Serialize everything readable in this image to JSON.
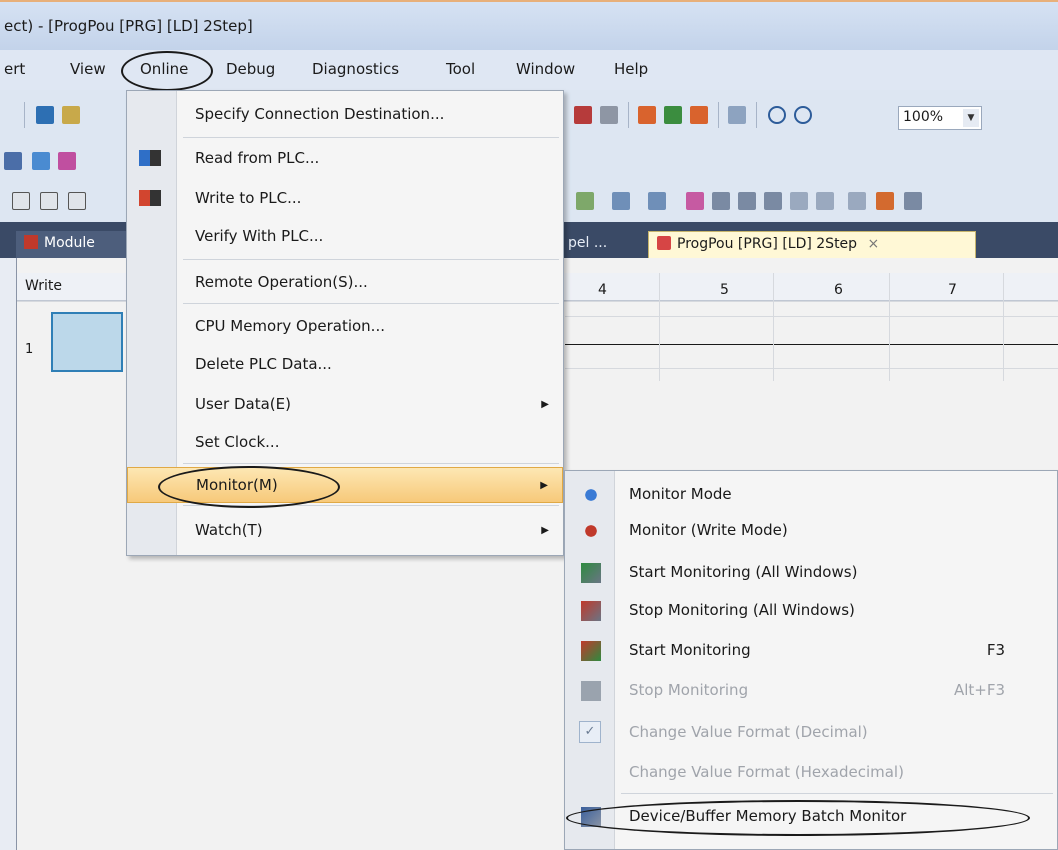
{
  "window": {
    "title": "ect) - [ProgPou [PRG] [LD] 2Step]"
  },
  "menubar": {
    "items": [
      "ert",
      "View",
      "Online",
      "Debug",
      "Diagnostics",
      "Tool",
      "Window",
      "Help"
    ]
  },
  "toolbar": {
    "zoom": "100%"
  },
  "tabs": {
    "module": "Module",
    "pel": "pel ...",
    "active": "ProgPou [PRG] [LD] 2Step",
    "close": "×"
  },
  "editor": {
    "write_label": "Write",
    "row_number": "1",
    "columns": [
      "4",
      "5",
      "6",
      "7"
    ]
  },
  "online_menu": {
    "items": [
      {
        "label": "Specify Connection Destination..."
      },
      {
        "label": "Read from PLC..."
      },
      {
        "label": "Write to PLC..."
      },
      {
        "label": "Verify With PLC..."
      },
      {
        "label": "Remote Operation(S)..."
      },
      {
        "label": "CPU Memory Operation..."
      },
      {
        "label": "Delete PLC Data..."
      },
      {
        "label": "User Data(E)"
      },
      {
        "label": "Set Clock..."
      },
      {
        "label": "Monitor(M)"
      },
      {
        "label": "Watch(T)"
      }
    ]
  },
  "monitor_menu": {
    "items": [
      {
        "label": "Monitor Mode",
        "key": ""
      },
      {
        "label": "Monitor (Write Mode)",
        "key": ""
      },
      {
        "label": "Start Monitoring (All Windows)",
        "key": ""
      },
      {
        "label": "Stop Monitoring (All Windows)",
        "key": ""
      },
      {
        "label": "Start Monitoring",
        "key": "F3"
      },
      {
        "label": "Stop Monitoring",
        "key": "Alt+F3"
      },
      {
        "label": "Change Value Format (Decimal)",
        "key": ""
      },
      {
        "label": "Change Value Format (Hexadecimal)",
        "key": ""
      },
      {
        "label": "Device/Buffer Memory Batch Monitor",
        "key": ""
      }
    ]
  },
  "colors": {
    "highlight": "#f7c97a",
    "tab_strip": "#3a4a66",
    "disabled_text": "#a0a4ab"
  }
}
